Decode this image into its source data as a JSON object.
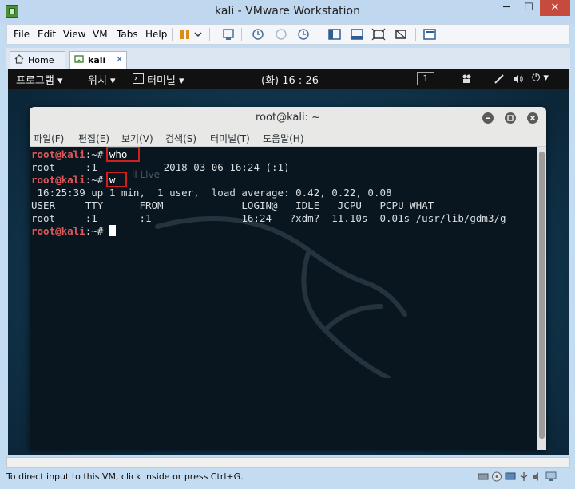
{
  "window": {
    "title": "kali - VMware Workstation",
    "minimize_glyph": "─",
    "maximize_glyph": "☐",
    "close_glyph": "✕"
  },
  "menubar": {
    "items": [
      "File",
      "Edit",
      "View",
      "VM",
      "Tabs",
      "Help"
    ]
  },
  "tabs": {
    "home_label": "Home",
    "kali_label": "kali",
    "close_glyph": "✕"
  },
  "gnome_panel": {
    "applications": "프로그램 ▾",
    "places": "위치 ▾",
    "terminal_app": "터미널 ▾",
    "clock": "(화) 16 : 26",
    "workspace": "1",
    "power_glyph": "⏻ ▾"
  },
  "terminal": {
    "title": "root@kali: ~",
    "menus": [
      "파일(F)",
      "편집(E)",
      "보기(V)",
      "검색(S)",
      "터미널(T)",
      "도움말(H)"
    ],
    "prompt_user": "root@kali",
    "prompt_rest": ":~# ",
    "commands": [
      "who",
      "w"
    ],
    "who_output": "root     :1           2018-03-06 16:24 (:1)",
    "w_header": " 16:25:39 up 1 min,  1 user,  load average: 0.42, 0.22, 0.08",
    "w_columns": "USER     TTY      FROM             LOGIN@   IDLE   JCPU   PCPU WHAT",
    "w_row": "root     :1       :1               16:24   ?xdm?  11.10s  0.01s /usr/lib/gdm3/g",
    "background_text": "li Live"
  },
  "status": {
    "text": "To direct input to this VM, click inside or press Ctrl+G."
  },
  "colors": {
    "prompt_user": "#e05757",
    "highlight_box": "#d01f1f",
    "close_button": "#c74a3f"
  }
}
